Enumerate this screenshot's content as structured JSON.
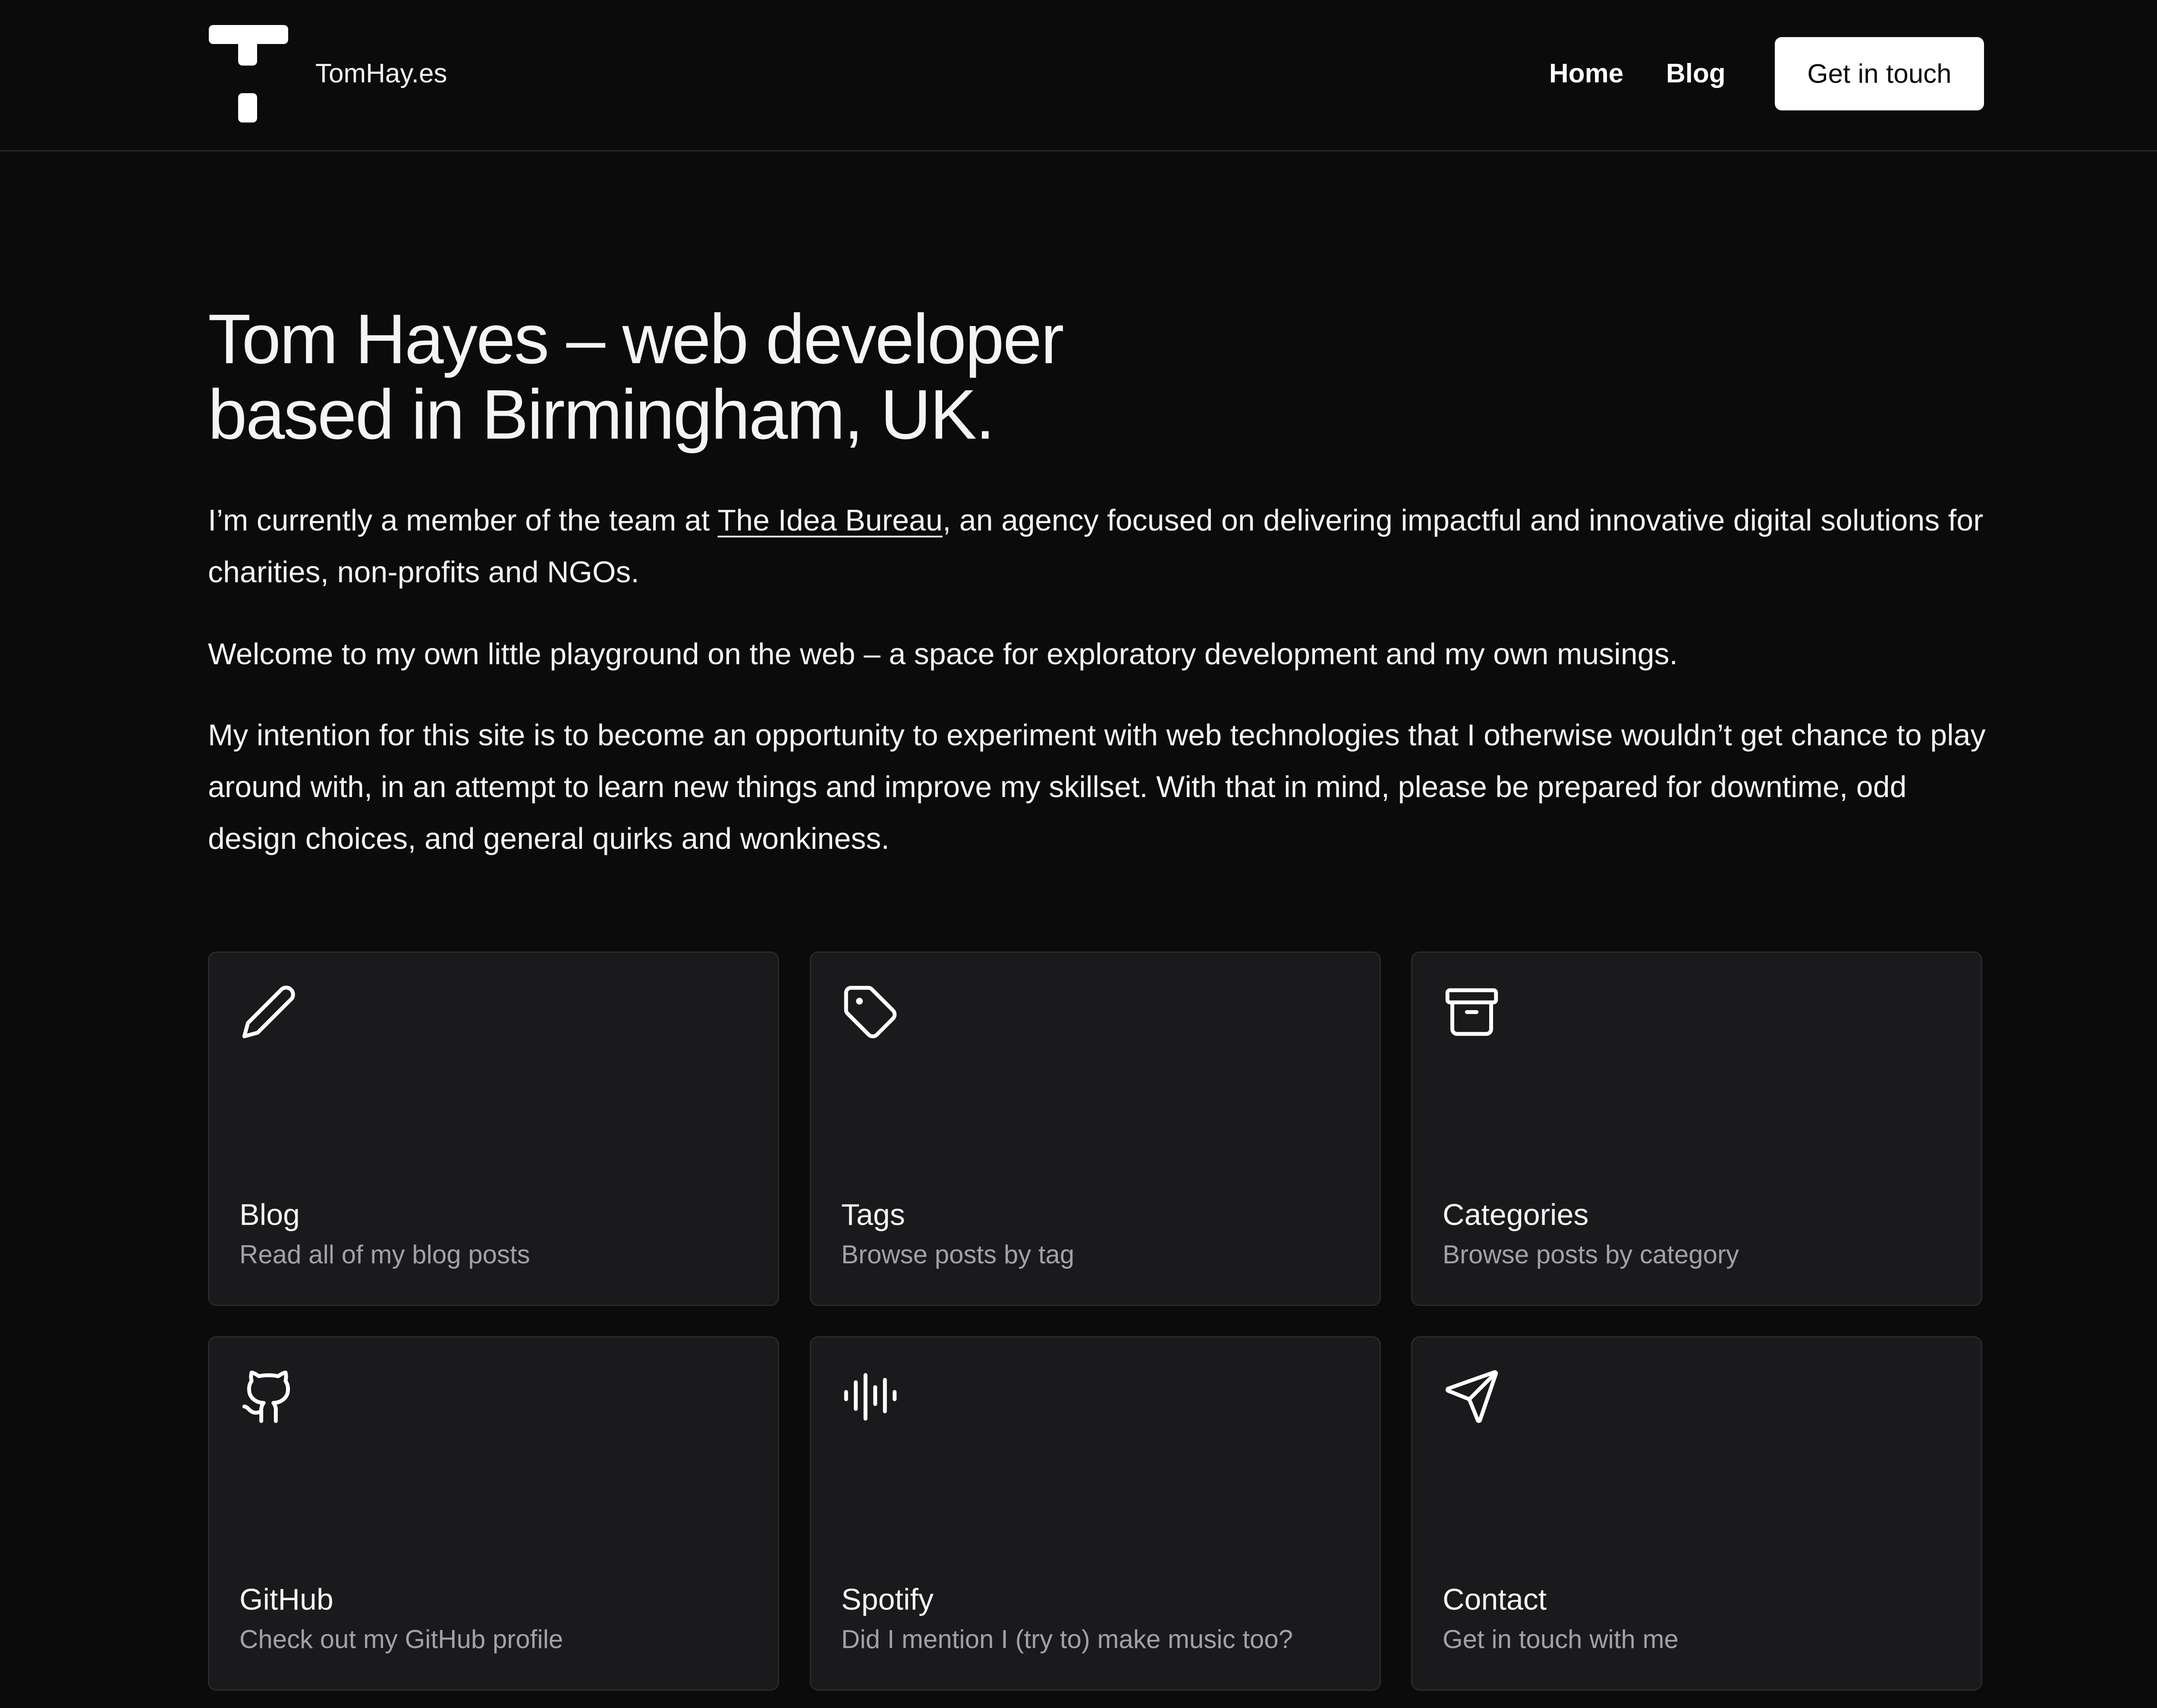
{
  "header": {
    "brand": "TomHay.es",
    "nav": {
      "home": "Home",
      "blog": "Blog"
    },
    "cta_label": "Get in touch"
  },
  "hero": {
    "title_line1": "Tom Hayes – web developer",
    "title_line2": "based in Birmingham, UK.",
    "p1_before": "I’m currently a member of the team at ",
    "p1_link": "The Idea Bureau",
    "p1_after": ", an agency focused on delivering impactful and innovative digital solutions for charities, non-profits and NGOs.",
    "p2": "Welcome to my own little playground on the web – a space for exploratory development and my own musings.",
    "p3": "My intention for this site is to become an opportunity to experiment with web technologies that I otherwise wouldn’t get chance to play around with, in an attempt to learn new things and improve my skillset. With that in mind, please be prepared for downtime, odd design choices, and general quirks and wonkiness."
  },
  "cards": [
    {
      "icon": "pencil-icon",
      "title": "Blog",
      "description": "Read all of my blog posts"
    },
    {
      "icon": "tag-icon",
      "title": "Tags",
      "description": "Browse posts by tag"
    },
    {
      "icon": "archive-icon",
      "title": "Categories",
      "description": "Browse posts by category"
    },
    {
      "icon": "github-icon",
      "title": "GitHub",
      "description": "Check out my GitHub profile"
    },
    {
      "icon": "audio-waveform-icon",
      "title": "Spotify",
      "description": "Did I mention I (try to) make music too?"
    },
    {
      "icon": "send-icon",
      "title": "Contact",
      "description": "Get in touch with me"
    }
  ],
  "colors": {
    "background": "#0b0b0c",
    "card_background": "#1a1a1c",
    "text": "#f4f4f5",
    "muted_text": "#a1a1aa",
    "button_background": "#ffffff"
  }
}
